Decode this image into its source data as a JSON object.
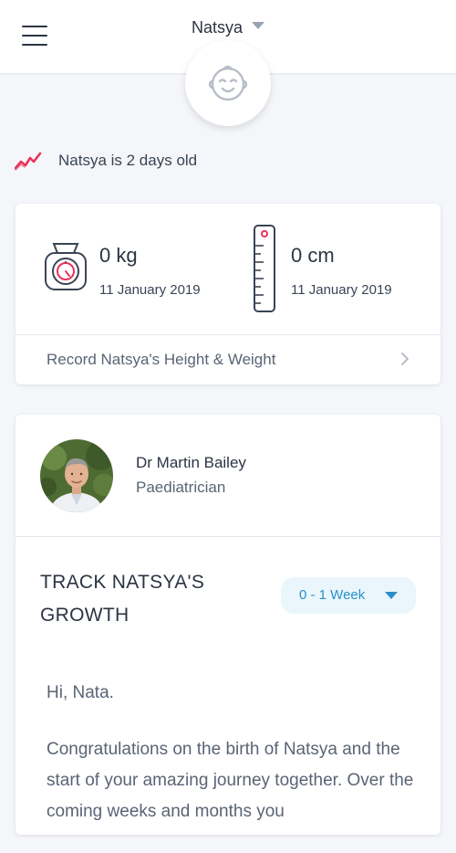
{
  "header": {
    "menu_icon": "hamburger-menu-icon",
    "child_name": "Natsya",
    "avatar_icon": "baby-face-icon"
  },
  "age": {
    "icon": "growth-trend-icon",
    "text": "Natsya is 2 days old",
    "accent_color": "#e8335a"
  },
  "measurements": {
    "weight": {
      "icon": "scale-icon",
      "value": "0 kg",
      "date": "11 January 2019"
    },
    "height": {
      "icon": "ruler-icon",
      "value": "0 cm",
      "date": "11 January 2019"
    },
    "record_link": "Record Natsya's Height & Weight",
    "record_icon": "chevron-right-icon"
  },
  "doctor": {
    "name": "Dr Martin Bailey",
    "role": "Paediatrician"
  },
  "track": {
    "title": "TRACK NATSYA'S GROWTH",
    "week_selected": "0 - 1 Week"
  },
  "message": {
    "greeting": "Hi, Nata.",
    "paragraph": "Congratulations on the birth of Natsya and the start of your amazing journey together. Over the coming weeks and months you"
  },
  "colors": {
    "background": "#f4f6f9",
    "accent_blue": "#2b8fc9",
    "accent_red": "#e8335a",
    "text_dark": "#2c3443",
    "text_muted": "#5a6475"
  }
}
